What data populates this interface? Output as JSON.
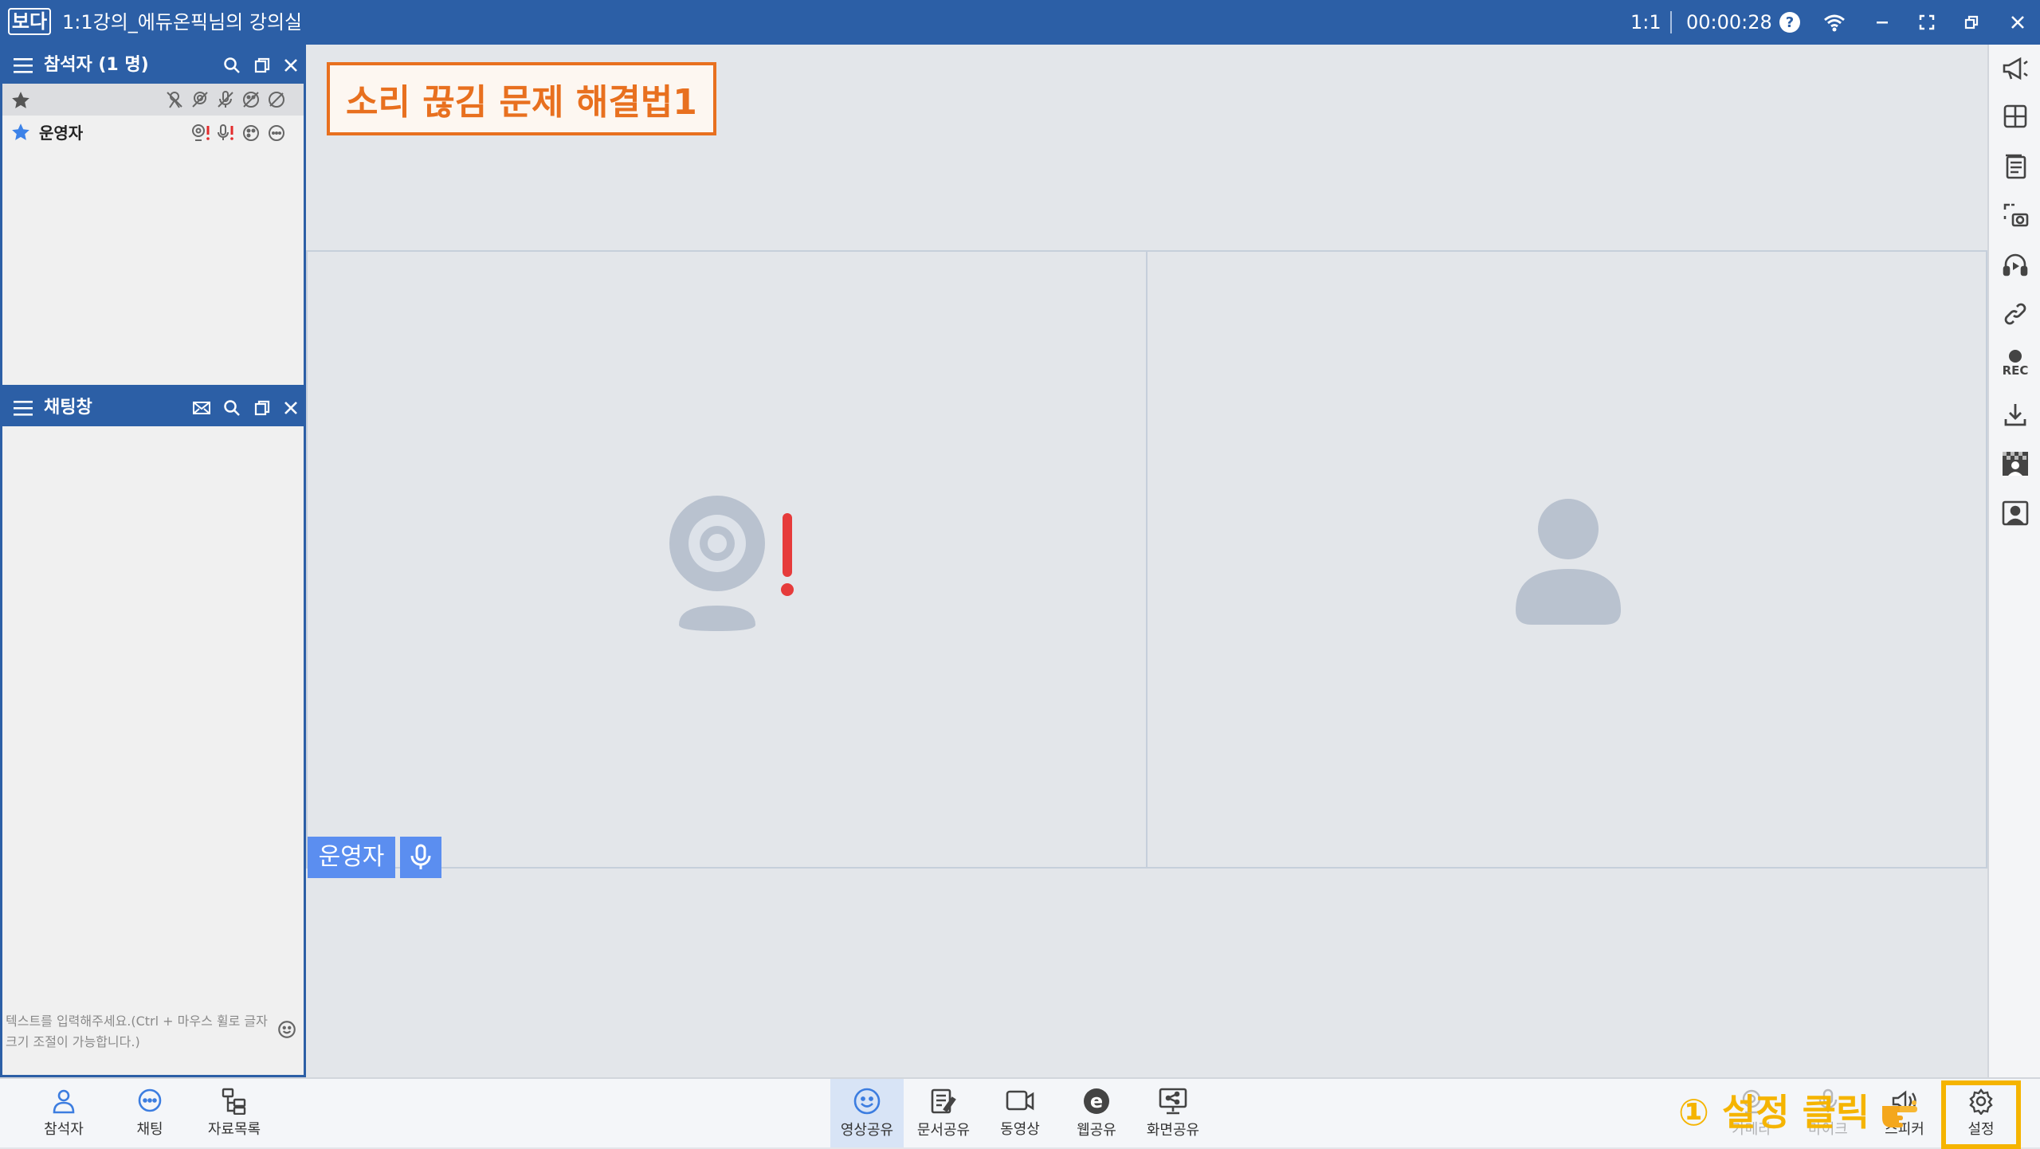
{
  "titlebar": {
    "logo": "보다",
    "title": "1:1강의_에듀온픽님의 강의실",
    "ratio": "1:1",
    "timer": "00:00:28"
  },
  "participants_panel": {
    "title": "참석자 (1 명)",
    "rows": [
      {
        "name": ""
      },
      {
        "name": "운영자"
      }
    ]
  },
  "chat_panel": {
    "title": "채팅창",
    "input_placeholder": "텍스트를 입력해주세요.(Ctrl + 마우스 휠로 글자 크기 조절이 가능합니다.)"
  },
  "annotation_title": "소리 끊김 문제 해결법1",
  "video": {
    "name_label": "운영자"
  },
  "bottom_left": [
    {
      "label": "참석자",
      "icon": "person-icon"
    },
    {
      "label": "채팅",
      "icon": "chat-icon"
    },
    {
      "label": "자료목록",
      "icon": "folder-tree-icon"
    }
  ],
  "bottom_center": [
    {
      "label": "영상공유",
      "icon": "smile-icon",
      "active": true
    },
    {
      "label": "문서공유",
      "icon": "document-share-icon"
    },
    {
      "label": "동영상",
      "icon": "video-icon"
    },
    {
      "label": "웹공유",
      "icon": "web-icon"
    },
    {
      "label": "화면공유",
      "icon": "screen-share-icon"
    }
  ],
  "bottom_right": [
    {
      "label": "카메라",
      "icon": "camera-icon"
    },
    {
      "label": "마이크",
      "icon": "mic-icon"
    },
    {
      "label": "스피커",
      "icon": "speaker-icon"
    },
    {
      "label": "설정",
      "icon": "gear-icon"
    }
  ],
  "annotation_step": "① 설정 클릭",
  "right_toolbar": [
    "megaphone-icon",
    "layout-grid-icon",
    "notes-icon",
    "capture-icon",
    "headset-icon",
    "link-icon",
    "record-icon",
    "download-icon",
    "mosaic-icon",
    "profile-icon"
  ],
  "rec_label": "REC",
  "colors": {
    "titlebar": "#2c5fa6",
    "accent": "#5b8ef0",
    "annotation": "#e8701f",
    "highlight": "#f5b400"
  }
}
